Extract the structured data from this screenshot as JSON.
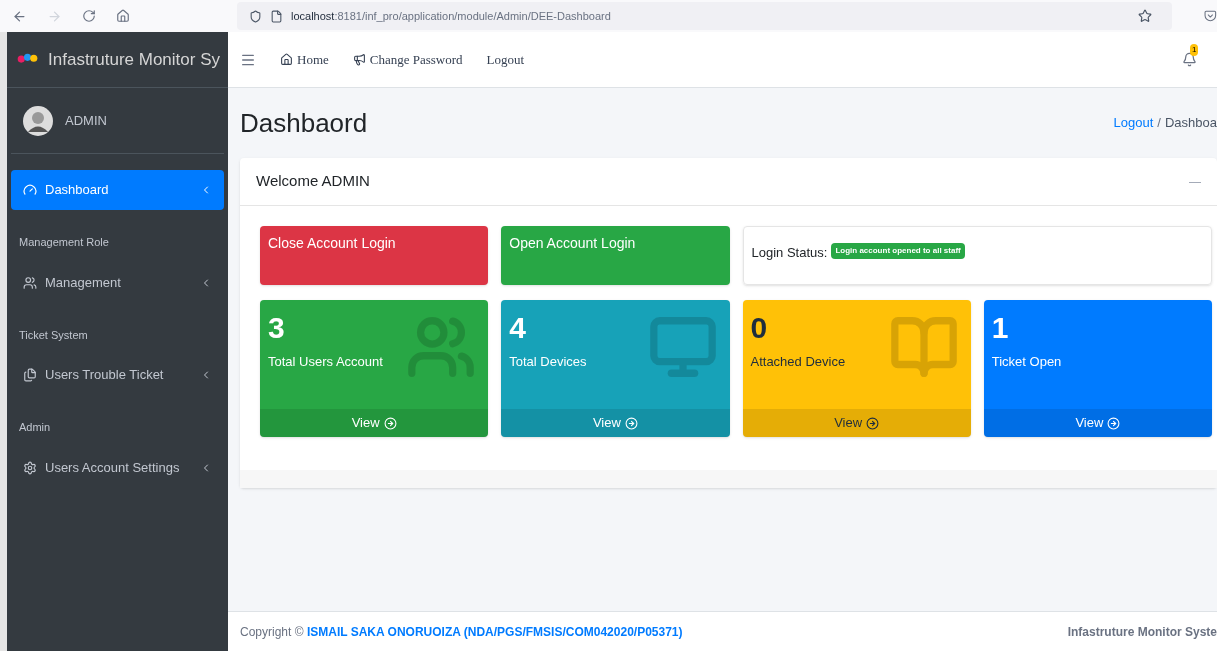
{
  "browser": {
    "url_host": "localhost",
    "url_rest": ":8181/inf_pro/application/module/Admin/DEE-Dashboard"
  },
  "brand": {
    "title": "Infastruture Monitor Sy"
  },
  "user": {
    "name": "ADMIN"
  },
  "sidebar": {
    "sections": [
      {
        "item": {
          "label": "Dashboard",
          "selected": true
        }
      },
      {
        "header": "Management Role",
        "item": {
          "label": "Management",
          "selected": false
        }
      },
      {
        "header": "Ticket System",
        "item": {
          "label": "Users Trouble Ticket",
          "selected": false
        }
      },
      {
        "header": "Admin",
        "item": {
          "label": "Users Account Settings",
          "selected": false
        }
      }
    ]
  },
  "navbar": {
    "links": [
      "Home",
      "Change Password",
      "Logout"
    ],
    "notification_count": "1"
  },
  "page": {
    "title": "Dashbaord",
    "breadcrumb": [
      "Logout",
      "/",
      "Dashboa"
    ]
  },
  "card": {
    "title": "Welcome ADMIN",
    "collapse": "—",
    "actions": [
      {
        "label": "Close Account Login",
        "color": "#dc3545"
      },
      {
        "label": "Open Account Login",
        "color": "#28a745"
      }
    ],
    "login_status": {
      "label": "Login Status:",
      "badge": "Login account opened to all staff"
    },
    "stats": [
      {
        "value": "3",
        "label": "Total Users Account",
        "link": "View",
        "color": "#28a745"
      },
      {
        "value": "4",
        "label": "Total Devices",
        "link": "View",
        "color": "#17a2b8"
      },
      {
        "value": "0",
        "label": "Attached Device",
        "link": "View",
        "color": "#ffc107"
      },
      {
        "value": "1",
        "label": "Ticket Open",
        "link": "View",
        "color": "#007bff"
      }
    ]
  },
  "footer": {
    "copyright": "Copyright © **ISMAIL SAKA ONORUOIZA (NDA/PGS/FMSIS/COM042020/P05371)**",
    "right": "Infastruture Monitor Syste"
  }
}
